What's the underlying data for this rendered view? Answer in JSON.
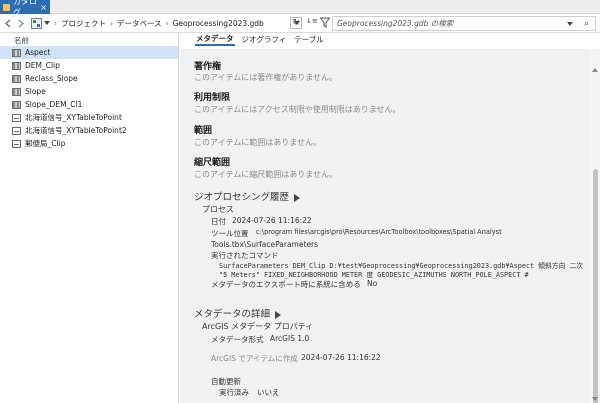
{
  "tab": {
    "label": "カタログ",
    "close": "×"
  },
  "toolbar": {
    "breadcrumb": [
      "プロジェクト",
      "データベース",
      "Geoprocessing2023.gdb"
    ],
    "search_placeholder": "Geoprocessing2023.gdb の検索",
    "refresh": "↻",
    "sort": "↓≡"
  },
  "left": {
    "column_header": "名前",
    "items": [
      {
        "label": "Aspect",
        "icon": "raster-icon",
        "selected": true
      },
      {
        "label": "DEM_Clip",
        "icon": "raster-icon"
      },
      {
        "label": "Reclass_Slope",
        "icon": "raster-icon"
      },
      {
        "label": "Slope",
        "icon": "raster-icon"
      },
      {
        "label": "Slope_DEM_Cl1",
        "icon": "raster-icon"
      },
      {
        "label": "北海道信号_XYTableToPoint",
        "icon": "table-icon"
      },
      {
        "label": "北海道信号_XYTableToPoint2",
        "icon": "table-icon"
      },
      {
        "label": "郵便局_Clip",
        "icon": "table-icon"
      }
    ]
  },
  "right": {
    "subtabs": [
      "メタデータ",
      "ジオグラフィ",
      "テーブル"
    ],
    "sections": {
      "copyright_title": "著作権",
      "copyright_text": "このアイテムには著作権がありません。",
      "limits_title": "利用制限",
      "limits_text": "このアイテムにはアクセス制限や使用制限はありません。",
      "extent_title": "範囲",
      "extent_text": "このアイテムに範囲はありません。",
      "scale_title": "縮尺範囲",
      "scale_text": "このアイテムに縮尺範囲はありません。",
      "gp_history_title": "ジオプロセシング履歴",
      "process_title": "プロセス",
      "date_label": "日付",
      "date_value": "2024-07-26",
      "time_value": "11:16:22",
      "tool_label": "ツール位置",
      "tool_value": "c:\\program files\\arcgis\\pro\\Resources\\ArcToolbox\\toolboxes\\Spatial Analyst",
      "tool_value2": "Tools.tbx\\SurfaceParameters",
      "command_label": "実行されたコマンド",
      "command_line1": "SurfaceParameters DEM_Clip D:¥test¥Geoprocessing¥Geoprocessing2023.gdb¥Aspect 傾斜方向 二次",
      "command_line2": "\"5 Meters\" FIXED_NEIGHBORHOOD METER 度 GEODESIC_AZIMUTHS NORTH_POLE_ASPECT #",
      "export_label": "メタデータのエクスポート時に系統に含める",
      "export_value": "No",
      "details_title": "メタデータの詳細",
      "props_title": "ArcGIS メタデータ プロパティ",
      "format_label": "メタデータ形式",
      "format_value": "ArcGIS 1.0",
      "created_label": "ArcGIS でアイテムに作成",
      "created_date": "2024-07-26",
      "created_time": "11:16:22",
      "autoupdate_title": "自動更新",
      "executed_label": "実行済み",
      "executed_value": "いいえ"
    }
  }
}
